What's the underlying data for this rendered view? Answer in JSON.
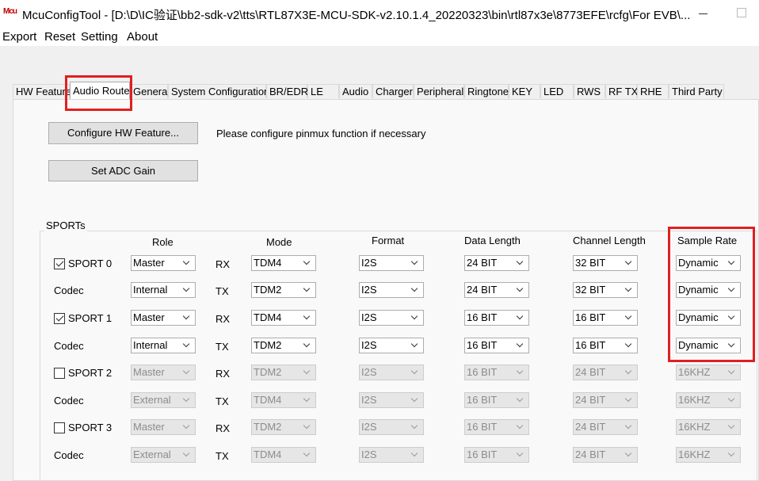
{
  "window": {
    "app_icon_text": "Mcu",
    "title": "McuConfigTool - [D:\\D\\IC验证\\bb2-sdk-v2\\tts\\RTL87X3E-MCU-SDK-v2.10.1.4_20220323\\bin\\rtl87x3e\\8773EFE\\rcfg\\For EVB\\..."
  },
  "menu": [
    "Export",
    "Reset",
    "Setting",
    "About"
  ],
  "tabs": [
    "HW Feature",
    "Audio Route",
    "General",
    "System Configuration",
    "BR/EDR",
    "LE",
    "Audio",
    "Charger",
    "Peripheral",
    "Ringtone",
    "KEY",
    "LED",
    "RWS",
    "RF TX",
    "RHE",
    "Third Party"
  ],
  "active_tab": "Audio Route",
  "actions": {
    "configure_hw": "Configure HW Feature...",
    "configure_hint": "Please configure pinmux function if necessary",
    "set_adc_gain": "Set ADC Gain"
  },
  "sports": {
    "legend": "SPORTs",
    "headers": {
      "role": "Role",
      "mode": "Mode",
      "format": "Format",
      "data_length": "Data Length",
      "channel_length": "Channel Length",
      "sample_rate": "Sample Rate"
    },
    "rows": [
      {
        "label": "SPORT 0",
        "checkbox": true,
        "checked": true,
        "enabled": true,
        "dir": "RX",
        "role": "Master",
        "mode": "TDM4",
        "format": "I2S",
        "data_length": "24 BIT",
        "channel_length": "32 BIT",
        "sample_rate": "Dynamic"
      },
      {
        "label": "Codec",
        "checkbox": false,
        "enabled": true,
        "dir": "TX",
        "role": "Internal",
        "mode": "TDM2",
        "format": "I2S",
        "data_length": "24 BIT",
        "channel_length": "32 BIT",
        "sample_rate": "Dynamic"
      },
      {
        "label": "SPORT 1",
        "checkbox": true,
        "checked": true,
        "enabled": true,
        "dir": "RX",
        "role": "Master",
        "mode": "TDM4",
        "format": "I2S",
        "data_length": "16 BIT",
        "channel_length": "16 BIT",
        "sample_rate": "Dynamic"
      },
      {
        "label": "Codec",
        "checkbox": false,
        "enabled": true,
        "dir": "TX",
        "role": "Internal",
        "mode": "TDM2",
        "format": "I2S",
        "data_length": "16 BIT",
        "channel_length": "16 BIT",
        "sample_rate": "Dynamic"
      },
      {
        "label": "SPORT 2",
        "checkbox": true,
        "checked": false,
        "enabled": false,
        "dir": "RX",
        "role": "Master",
        "mode": "TDM2",
        "format": "I2S",
        "data_length": "16 BIT",
        "channel_length": "24 BIT",
        "sample_rate": "16KHZ"
      },
      {
        "label": "Codec",
        "checkbox": false,
        "enabled": false,
        "dir": "TX",
        "role": "External",
        "mode": "TDM4",
        "format": "I2S",
        "data_length": "16 BIT",
        "channel_length": "24 BIT",
        "sample_rate": "16KHZ"
      },
      {
        "label": "SPORT 3",
        "checkbox": true,
        "checked": false,
        "enabled": false,
        "dir": "RX",
        "role": "Master",
        "mode": "TDM2",
        "format": "I2S",
        "data_length": "16 BIT",
        "channel_length": "24 BIT",
        "sample_rate": "16KHZ"
      },
      {
        "label": "Codec",
        "checkbox": false,
        "enabled": false,
        "dir": "TX",
        "role": "External",
        "mode": "TDM4",
        "format": "I2S",
        "data_length": "16 BIT",
        "channel_length": "24 BIT",
        "sample_rate": "16KHZ"
      }
    ]
  },
  "colors": {
    "highlight": "#e02020",
    "window_bg": "#f0f0f0",
    "disabled_text": "#8c8c8c"
  }
}
